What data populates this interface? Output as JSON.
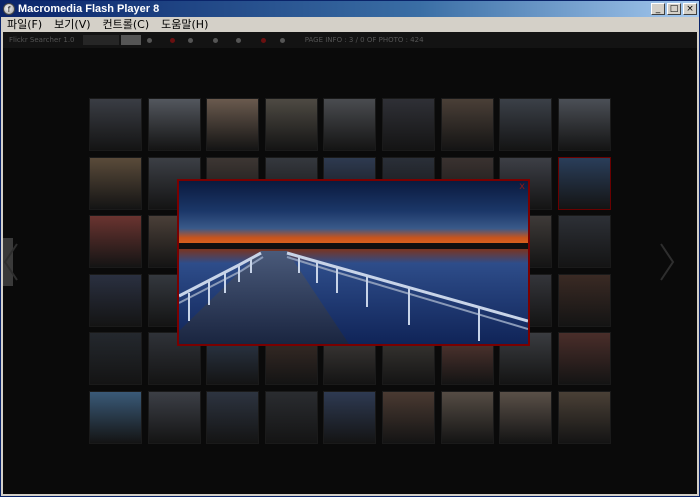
{
  "window": {
    "title": "Macromedia Flash Player 8",
    "minimize": "_",
    "maximize": "□",
    "close": "×"
  },
  "menu": [
    "파일(F)",
    "보기(V)",
    "컨트롤(C)",
    "도움말(H)"
  ],
  "toolbar": {
    "searcher": "Flickr Searcher 1.0",
    "page_info": "PAGE INFO : 3 / 0 OF PHOTO : 424"
  },
  "thumbs": [
    [
      "#3a3d44",
      "#53575e",
      "#6a5a4e",
      "#4e4a43",
      "#4a4c50",
      "#2f3036",
      "#4a3f37",
      "#3b4048",
      "#4b4f56"
    ],
    [
      "#5a4b3a",
      "#3c3f45",
      "#3d3633",
      "#35383e",
      "#2e3a50",
      "#2a2f38",
      "#3a3230",
      "#3d3f46",
      "#2a3e5a"
    ],
    [
      "#6a3430",
      "#4a3f38",
      "#30343a",
      "#2a2e36",
      "#2c3a4a",
      "#383838",
      "#2f2f35",
      "#3e3a38",
      "#2d3036"
    ],
    [
      "#2a3040",
      "#34383e",
      "#262a30",
      "#2c2f35",
      "#2b2f34",
      "#3c3632",
      "#3a3e44",
      "#34353a",
      "#3a2a24"
    ],
    [
      "#24282e",
      "#2f3238",
      "#2e3a4c",
      "#3c2e28",
      "#403c3a",
      "#3d3a36",
      "#5a3a34",
      "#3a3c40",
      "#4a2e2a"
    ],
    [
      "#3a5a78",
      "#3c3f46",
      "#2d3440",
      "#2a2c30",
      "#2e3a52",
      "#4a3a32",
      "#554c44",
      "#5a5048",
      "#4a4036"
    ]
  ],
  "popup_close": "x"
}
